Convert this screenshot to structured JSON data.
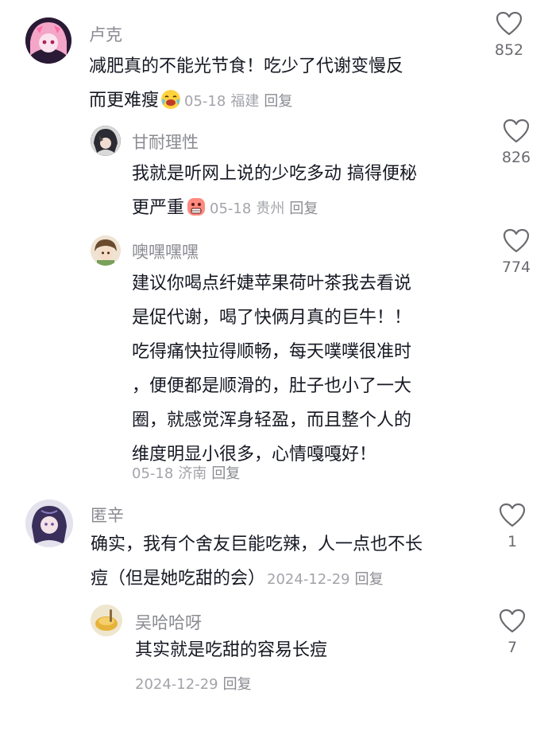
{
  "comments": [
    {
      "username": "卢克",
      "lines": [
        "减肥真的不能光节食！吃少了代谢变慢反",
        "而更难瘦"
      ],
      "date": "05-18",
      "location": "福建",
      "reply": "回复",
      "likes": "852",
      "emoji": "crying-laughing-emoji",
      "avatar": "anime-avatar-pink-hair"
    },
    {
      "username": "甘耐理性",
      "lines": [
        "我就是听网上说的少吃多动 搞得便秘",
        "更严重"
      ],
      "date": "05-18",
      "location": "贵州",
      "reply": "回复",
      "likes": "826",
      "emoji": "grimace-emoji",
      "avatar": "anime-avatar-dark-hair"
    },
    {
      "username": "噢嘿嘿嘿",
      "lines": [
        "建议你喝点纤婕苹果荷叶茶我去看说",
        "是促代谢，喝了快俩月真的巨牛！！",
        "吃得痛快拉得顺畅，每天噗噗很准时",
        "，便便都是顺滑的，肚子也小了一大",
        "圈，就感觉浑身轻盈，而且整个人的",
        "维度明显小很多，心情嘎嘎好！"
      ],
      "date": "05-18",
      "location": "济南",
      "reply": "回复",
      "likes": "774",
      "avatar": "anime-avatar-brown-hair"
    },
    {
      "username": "匿辛",
      "lines": [
        "确实，我有个舍友巨能吃辣，人一点也不长",
        "痘（但是她吃甜的会）"
      ],
      "date": "2024-12-29",
      "location": "",
      "reply": "回复",
      "likes": "1",
      "avatar": "anime-avatar-purple-hair"
    },
    {
      "username": "吴哈哈呀",
      "lines": [
        "其实就是吃甜的容易长痘"
      ],
      "date": "2024-12-29",
      "location": "",
      "reply": "回复",
      "likes": "7",
      "avatar": "food-photo-avatar"
    }
  ],
  "colors": {
    "text": "#161823",
    "username": "#8a8b91",
    "meta": "#a3a4aa",
    "like_icon": "#6a6b70"
  }
}
